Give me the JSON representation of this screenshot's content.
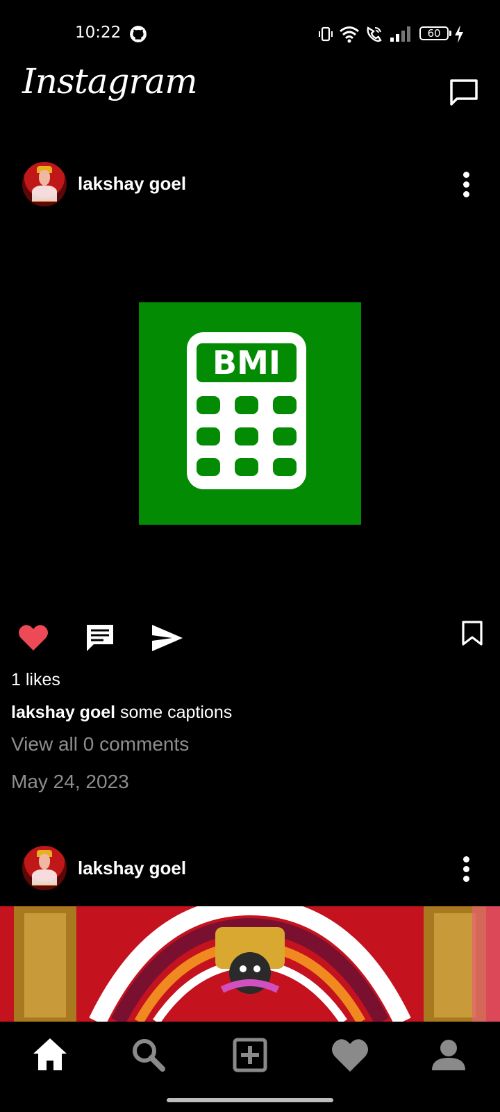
{
  "status_bar": {
    "time": "10:22",
    "battery": "60",
    "icons": [
      "github-icon",
      "vibrate-icon",
      "wifi-icon",
      "wifi-call-icon",
      "signal-icon",
      "battery-icon",
      "charging-icon"
    ]
  },
  "header": {
    "title": "Instagram",
    "icons": [
      "messages-icon"
    ]
  },
  "posts": [
    {
      "username": "lakshay goel",
      "image_text": "BMI",
      "likes": "1 likes",
      "caption_user": "lakshay goel",
      "caption_text": " some captions",
      "comments_link": "View all 0 comments",
      "date": "May 24, 2023",
      "liked": true
    },
    {
      "username": "lakshay goel"
    }
  ],
  "actions": {
    "icons": [
      "heart-icon",
      "comment-icon",
      "share-icon",
      "bookmark-icon"
    ]
  },
  "bottom_nav": {
    "items": [
      "home-icon",
      "search-icon",
      "add-post-icon",
      "activity-heart-icon",
      "profile-icon"
    ],
    "active": "home-icon"
  },
  "colors": {
    "background": "#000000",
    "like_red": "#ed4956",
    "bmi_green": "#038b03",
    "muted_text": "#8e8e8e"
  }
}
